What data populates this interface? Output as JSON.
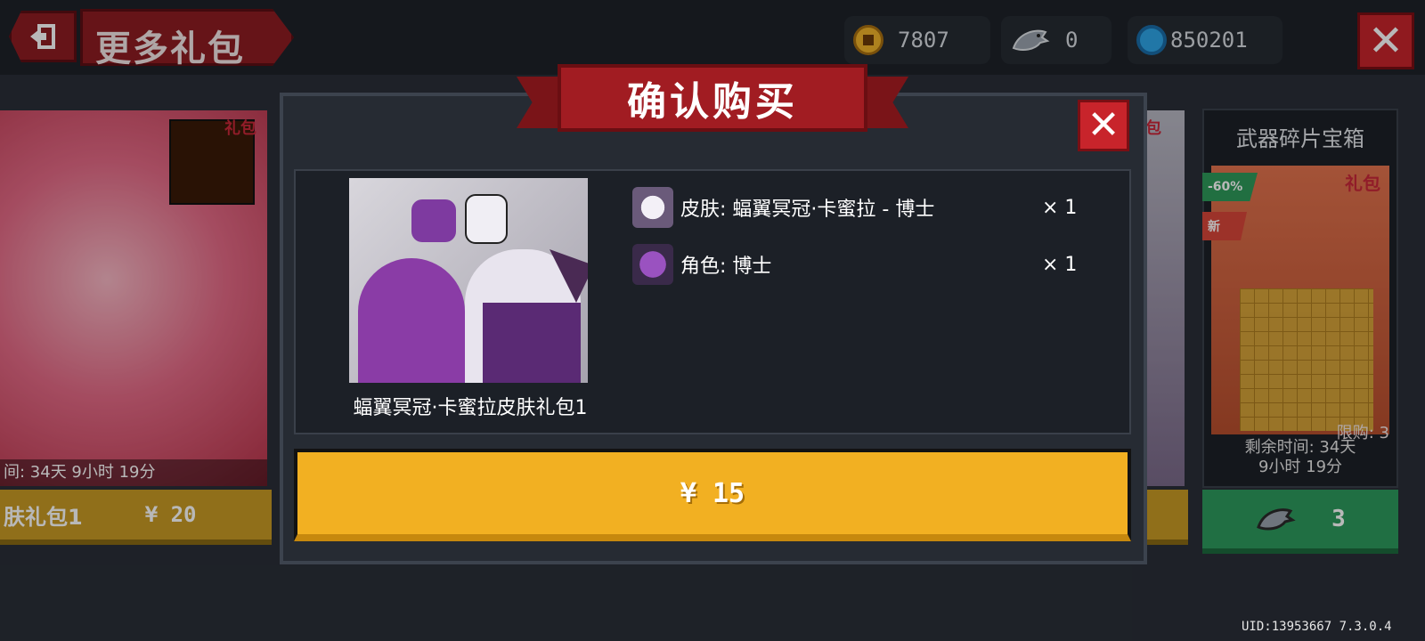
{
  "header": {
    "title": "更多礼包",
    "currencies": [
      {
        "name": "gold",
        "amount": "7807",
        "icon": "gold-coin-icon"
      },
      {
        "name": "fish",
        "amount": "0",
        "icon": "fish-icon"
      },
      {
        "name": "gem",
        "amount": "850201",
        "icon": "blue-gem-icon"
      }
    ],
    "close_label": "✕"
  },
  "bg_cards": {
    "left": {
      "tag": "礼包",
      "timer": "间: 34天 9小时 19分",
      "name": "肤礼包1",
      "price": "¥ 20"
    },
    "middle": {
      "tag": "礼包"
    },
    "right": {
      "title": "武器碎片宝箱",
      "tag": "礼包",
      "discount": "-60%",
      "new_badge": "新",
      "limit": "限购: 3",
      "remaining_line1": "剩余时间: 34天",
      "remaining_line2": "9小时 19分",
      "price": "3"
    }
  },
  "dialog": {
    "title": "确认购买",
    "close_label": "✕",
    "pack_name": "蝠翼冥冠·卡蜜拉皮肤礼包1",
    "items": [
      {
        "label": "皮肤: 蝠翼冥冠·卡蜜拉 - 博士",
        "qty": "× 1",
        "icon": "skin-portrait-icon"
      },
      {
        "label": "角色: 博士",
        "qty": "× 1",
        "icon": "character-portrait-icon"
      }
    ],
    "buy_label": "¥ 15"
  },
  "footer": {
    "uid": "UID:13953667 7.3.0.4"
  }
}
